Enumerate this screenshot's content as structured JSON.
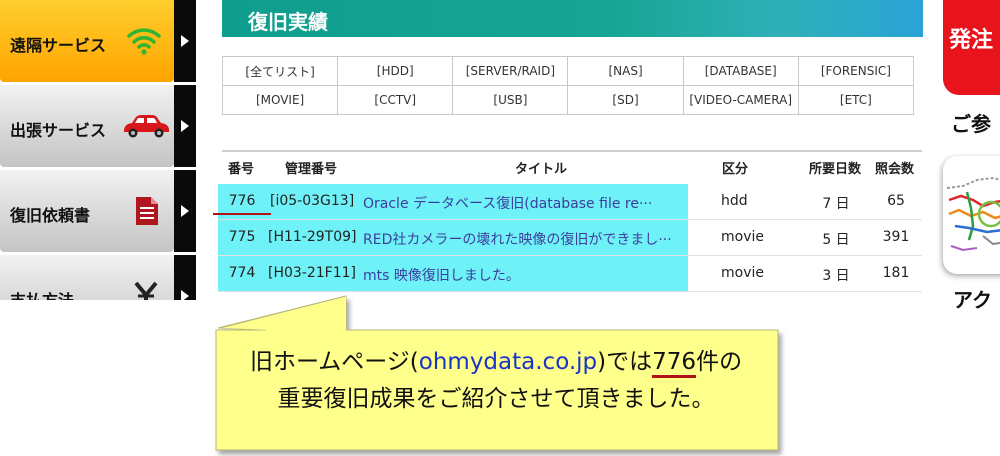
{
  "sidebar": {
    "items": [
      {
        "label": "遠隔サービス",
        "icon": "wifi-icon",
        "style": "orange"
      },
      {
        "label": "出張サービス",
        "icon": "car-icon",
        "style": "grey"
      },
      {
        "label": "復旧依頼書",
        "icon": "document-icon",
        "style": "grey"
      },
      {
        "label": "支払方法",
        "icon": "yen-icon",
        "style": "grey"
      }
    ]
  },
  "banner": {
    "title": "復旧実績"
  },
  "categories": [
    [
      "[全てリスト]",
      "[HDD]",
      "[SERVER/RAID]",
      "[NAS]",
      "[DATABASE]",
      "[FORENSIC]"
    ],
    [
      "[MOVIE]",
      "[CCTV]",
      "[USB]",
      "[SD]",
      "[VIDEO-CAMERA]",
      "[ETC]"
    ]
  ],
  "records": {
    "headers": {
      "number": "番号",
      "manage": "管理番号",
      "title": "タイトル",
      "category": "区分",
      "days": "所要日数",
      "views": "照会数"
    },
    "rows": [
      {
        "number": "776",
        "manage": "[i05-03G13]",
        "title": "Oracle データベース復旧(database file re···",
        "category": "hdd",
        "days": "7 日",
        "views": "65"
      },
      {
        "number": "775",
        "manage": "[H11-29T09]",
        "title": "RED社カメラーの壊れた映像の復旧ができまし···",
        "category": "movie",
        "days": "5 日",
        "views": "391"
      },
      {
        "number": "774",
        "manage": "[H03-21F11]",
        "title": "mts 映像復旧しました。",
        "category": "movie",
        "days": "3 日",
        "views": "181"
      }
    ]
  },
  "right": {
    "order_label": "発注",
    "reference_label": "ご参",
    "access_label": "アク"
  },
  "callout": {
    "line1_a": "旧ホームページ(",
    "line1_link": "ohmydata.co.jp",
    "line1_b": ")では",
    "line1_count": "776",
    "line1_c": "件の",
    "line2": "重要復旧成果をご紹介させて頂きました。"
  },
  "colors": {
    "accent_teal": "#17a593",
    "highlight_cyan": "#6ff2f7",
    "order_red": "#e8141c",
    "sidebar_orange": "#ffb000",
    "callout_yellow": "#ffff8c"
  }
}
